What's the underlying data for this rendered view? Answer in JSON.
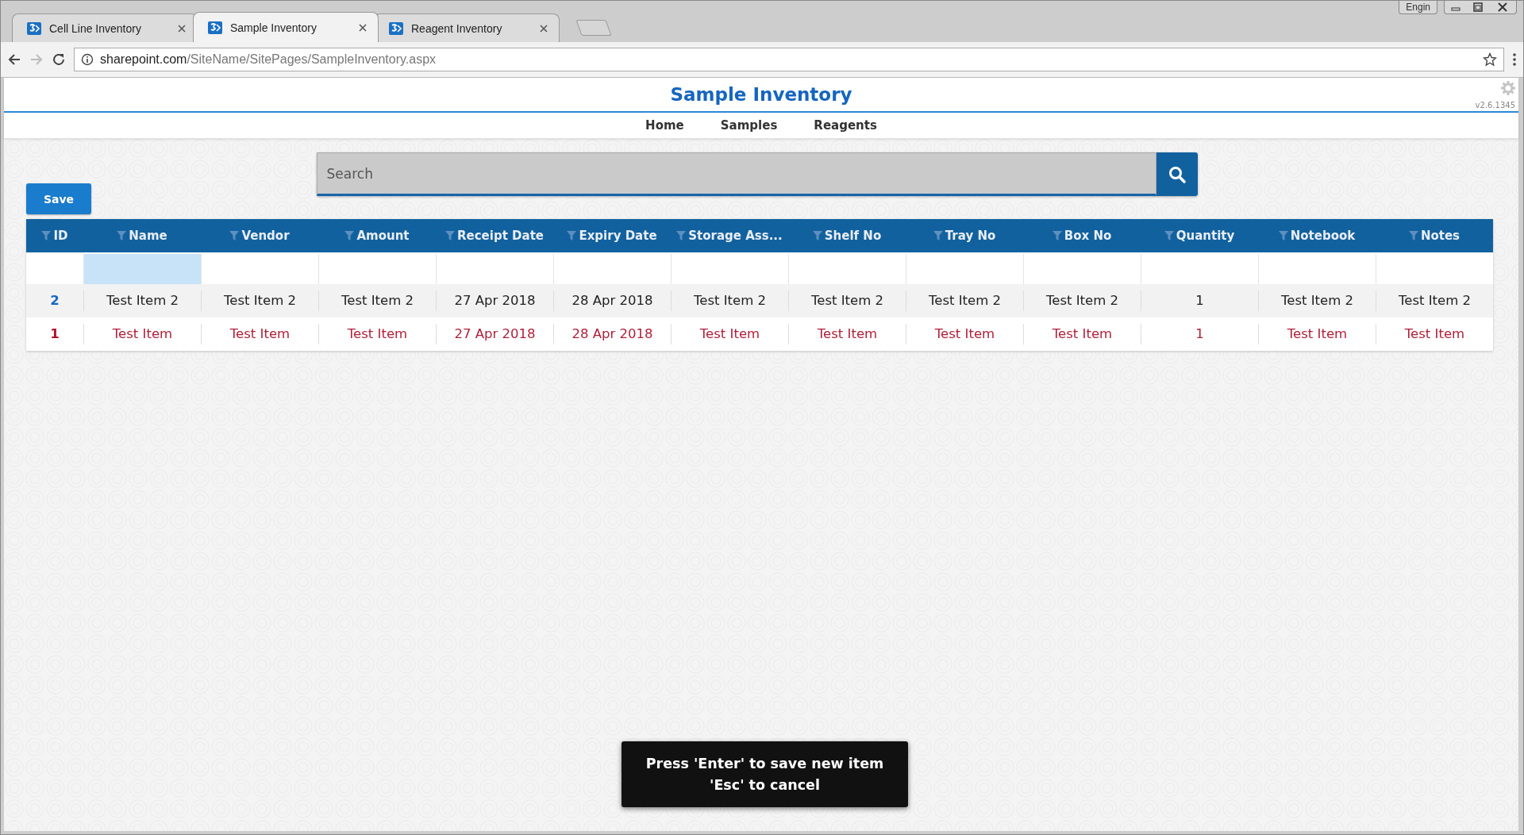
{
  "browser": {
    "tabs": [
      {
        "label": "Cell Line Inventory",
        "selected": false
      },
      {
        "label": "Sample Inventory",
        "selected": true
      },
      {
        "label": "Reagent Inventory",
        "selected": false
      }
    ],
    "profile": "Engin",
    "address": {
      "host": "sharepoint.com",
      "path": "/SiteName/SitePages/SampleInventory.aspx"
    }
  },
  "header": {
    "title": "Sample Inventory",
    "version": "v2.6.1345",
    "nav": [
      "Home",
      "Samples",
      "Reagents"
    ]
  },
  "search": {
    "placeholder": "Search"
  },
  "save_button": "Save",
  "table": {
    "columns": [
      "ID",
      "Name",
      "Vendor",
      "Amount",
      "Receipt Date",
      "Expiry Date",
      "Storage Ass...",
      "Shelf No",
      "Tray No",
      "Box No",
      "Quantity",
      "Notebook",
      "Notes"
    ],
    "new_row": {
      "cells": [
        {
          "selected": false
        },
        {
          "selected": true
        },
        {
          "selected": false
        },
        {
          "selected": false
        },
        {
          "selected": false
        },
        {
          "selected": false
        },
        {
          "selected": false
        },
        {
          "selected": false
        },
        {
          "selected": false
        },
        {
          "selected": false
        },
        {
          "selected": false
        },
        {
          "selected": false
        },
        {
          "selected": false
        }
      ]
    },
    "rows": [
      {
        "kind": "plain",
        "cells": [
          "2",
          "Test Item 2",
          "Test Item 2",
          "Test Item 2",
          "27 Apr 2018",
          "28 Apr 2018",
          "Test Item 2",
          "Test Item 2",
          "Test Item 2",
          "Test Item 2",
          "1",
          "Test Item 2",
          "Test Item 2"
        ]
      },
      {
        "kind": "flagged",
        "cells": [
          "1",
          "Test Item",
          "Test Item",
          "Test Item",
          "27 Apr 2018",
          "28 Apr 2018",
          "Test Item",
          "Test Item",
          "Test Item",
          "Test Item",
          "1",
          "Test Item",
          "Test Item"
        ]
      }
    ]
  },
  "toast": {
    "lines": [
      "Press 'Enter' to save new item",
      "'Esc' to cancel"
    ]
  }
}
